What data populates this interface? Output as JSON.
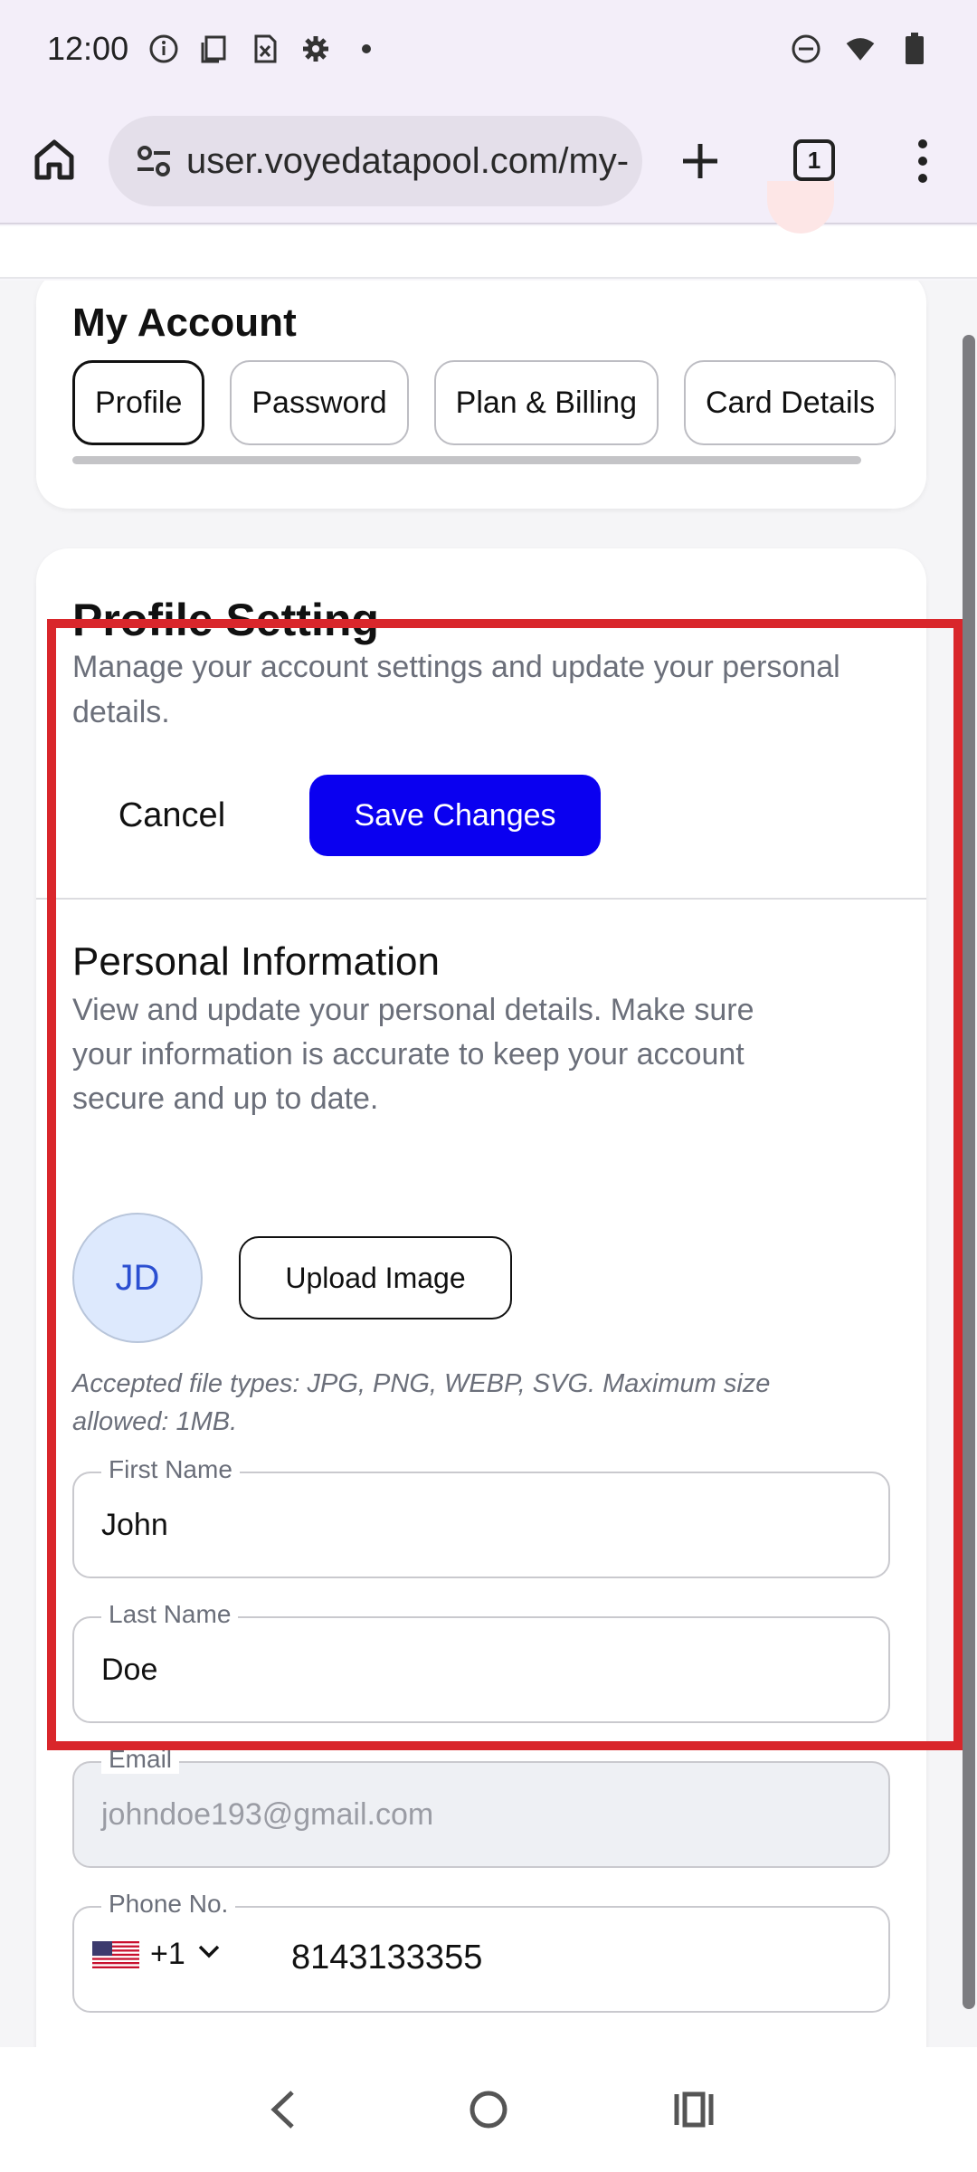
{
  "status_bar": {
    "time": "12:00"
  },
  "browser": {
    "url": "user.voyedatapool.com/my-",
    "tab_count": "1"
  },
  "account": {
    "title": "My Account",
    "tabs": [
      "Profile",
      "Password",
      "Plan & Billing",
      "Card Details"
    ],
    "active_tab": "Profile"
  },
  "profile": {
    "title": "Profile Setting",
    "description": "Manage your account settings and update your personal details.",
    "cancel_label": "Cancel",
    "save_label": "Save Changes"
  },
  "personal": {
    "title": "Personal Information",
    "description": "View and update your personal details. Make sure your information is accurate to keep your account secure and up to date.",
    "avatar_initials": "JD",
    "upload_label": "Upload Image",
    "file_note": "Accepted file types: JPG, PNG, WEBP, SVG. Maximum size allowed: 1MB."
  },
  "fields": {
    "first_name": {
      "label": "First Name",
      "value": "John"
    },
    "last_name": {
      "label": "Last Name",
      "value": "Doe"
    },
    "email": {
      "label": "Email",
      "value": "johndoe193@gmail.com"
    },
    "phone": {
      "label": "Phone No.",
      "country_code": "+1",
      "value": "8143133355"
    }
  },
  "colors": {
    "primary_button": "#0a00f0",
    "highlight_frame": "#d9262b",
    "avatar_bg": "#dde9fd"
  }
}
